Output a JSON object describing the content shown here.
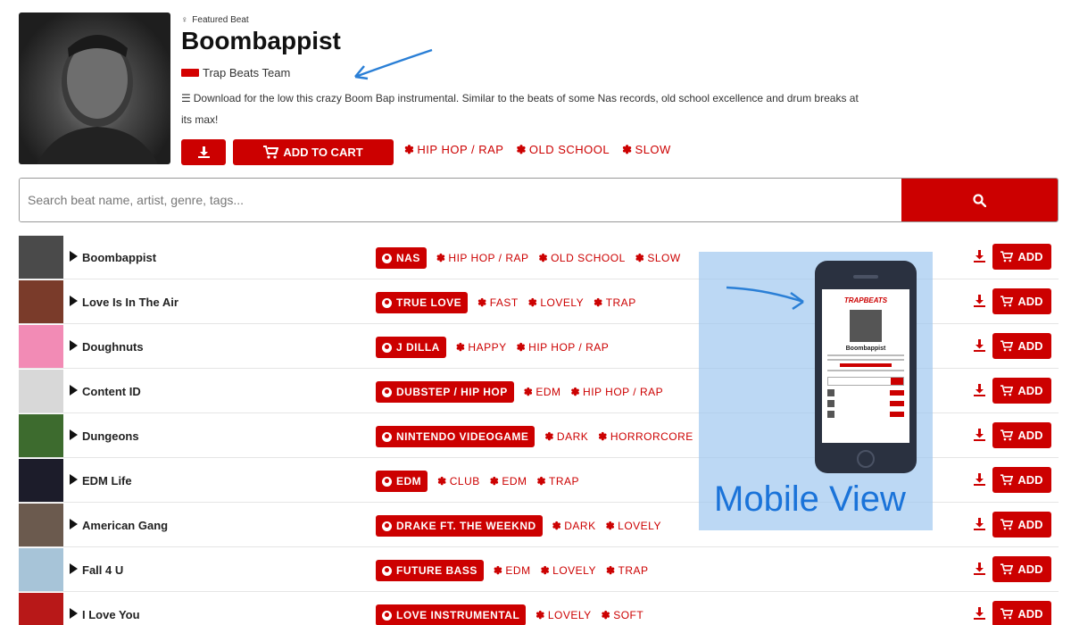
{
  "featured": {
    "kicker": "Featured Beat",
    "title": "Boombappist",
    "producer": "Trap Beats Team",
    "description": "Download for the low this crazy Boom Bap instrumental. Similar to the beats of some Nas records, old school excellence and drum breaks at its max!",
    "add_to_cart_label": "ADD TO CART",
    "tags": [
      "HIP HOP / RAP",
      "OLD SCHOOL",
      "SLOW"
    ]
  },
  "search": {
    "placeholder": "Search beat name, artist, genre, tags..."
  },
  "beats": [
    {
      "title": "Boombappist",
      "artist": "NAS",
      "tags": [
        "HIP HOP / RAP",
        "OLD SCHOOL",
        "SLOW"
      ],
      "add_label": "ADD"
    },
    {
      "title": "Love Is In The Air",
      "artist": "TRUE LOVE",
      "tags": [
        "FAST",
        "LOVELY",
        "TRAP"
      ],
      "add_label": "ADD"
    },
    {
      "title": "Doughnuts",
      "artist": "J DILLA",
      "tags": [
        "HAPPY",
        "HIP HOP / RAP"
      ],
      "add_label": "ADD"
    },
    {
      "title": "Content ID",
      "artist": "DUBSTEP / HIP HOP",
      "tags": [
        "EDM",
        "HIP HOP / RAP"
      ],
      "add_label": "ADD"
    },
    {
      "title": "Dungeons",
      "artist": "NINTENDO VIDEOGAME",
      "tags": [
        "DARK",
        "HORRORCORE"
      ],
      "add_label": "ADD"
    },
    {
      "title": "EDM Life",
      "artist": "EDM",
      "tags": [
        "CLUB",
        "EDM",
        "TRAP"
      ],
      "add_label": "ADD"
    },
    {
      "title": "American Gang",
      "artist": "DRAKE FT. THE WEEKND",
      "tags": [
        "DARK",
        "LOVELY"
      ],
      "add_label": "ADD"
    },
    {
      "title": "Fall 4 U",
      "artist": "FUTURE BASS",
      "tags": [
        "EDM",
        "LOVELY",
        "TRAP"
      ],
      "add_label": "ADD"
    },
    {
      "title": "I Love You",
      "artist": "LOVE INSTRUMENTAL",
      "tags": [
        "LOVELY",
        "SOFT"
      ],
      "add_label": "ADD"
    }
  ],
  "overlay": {
    "label": "Mobile View",
    "phone_logo": "TRAPBEATS",
    "phone_title": "Boombappist"
  },
  "colors": {
    "accent": "#cc0000",
    "overlay": "#a0c8f0",
    "overlay_text": "#1a73d9"
  },
  "icons": {
    "kicker": "person-icon",
    "description": "lines-icon",
    "download": "download-icon",
    "cart": "cart-icon",
    "search": "search-icon",
    "tag": "hashtag-icon",
    "play": "play-icon",
    "artist": "user-circle-icon"
  }
}
